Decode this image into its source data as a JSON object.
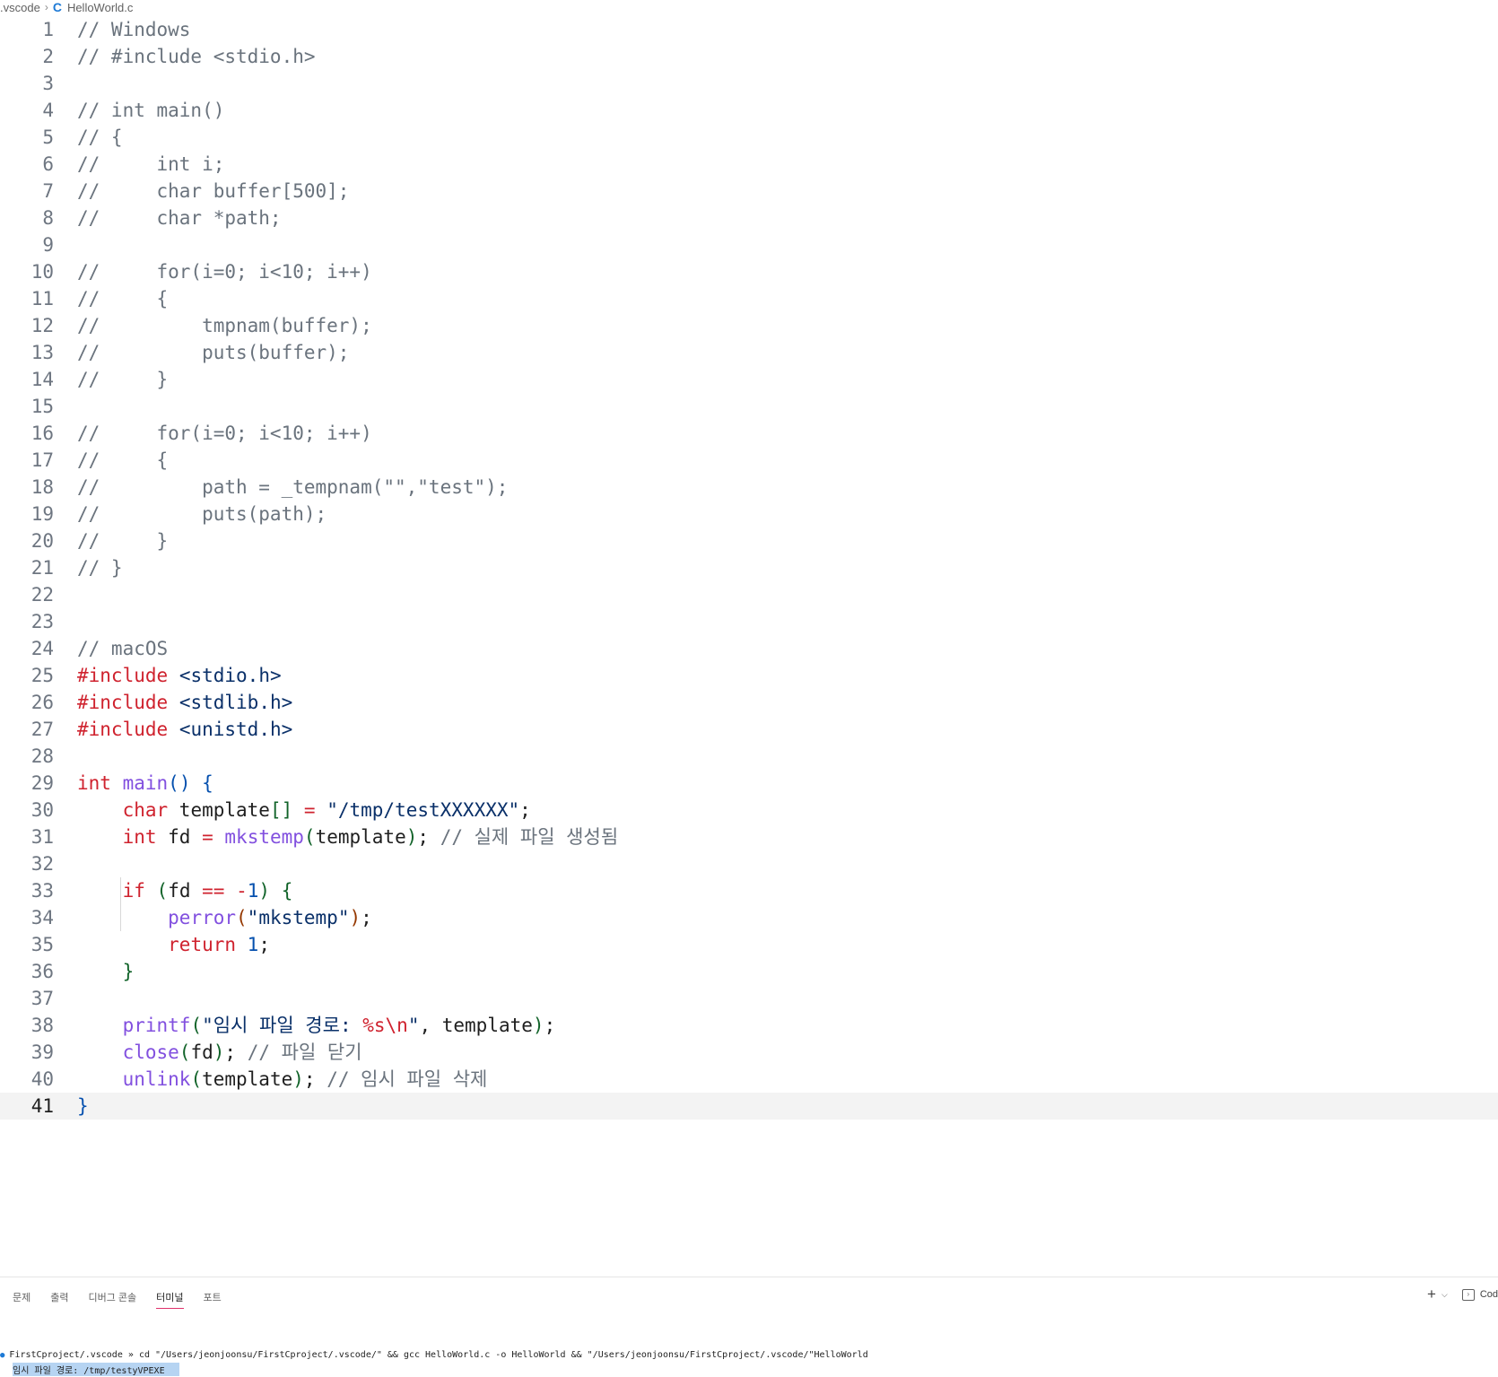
{
  "breadcrumb": {
    "folder": ".vscode",
    "file": "HelloWorld.c",
    "lang_icon": "C"
  },
  "editor": {
    "current_line": 41,
    "lines": [
      {
        "n": "1",
        "t": [
          [
            "c",
            "// Windows"
          ]
        ]
      },
      {
        "n": "2",
        "t": [
          [
            "c",
            "// #include <stdio.h>"
          ]
        ]
      },
      {
        "n": "3",
        "t": []
      },
      {
        "n": "4",
        "t": [
          [
            "c",
            "// int main()"
          ]
        ]
      },
      {
        "n": "5",
        "t": [
          [
            "c",
            "// {"
          ]
        ]
      },
      {
        "n": "6",
        "t": [
          [
            "c",
            "//     int i;"
          ]
        ]
      },
      {
        "n": "7",
        "t": [
          [
            "c",
            "//     char buffer[500];"
          ]
        ]
      },
      {
        "n": "8",
        "t": [
          [
            "c",
            "//     char *path;"
          ]
        ]
      },
      {
        "n": "9",
        "t": []
      },
      {
        "n": "10",
        "t": [
          [
            "c",
            "//     for(i=0; i<10; i++)"
          ]
        ]
      },
      {
        "n": "11",
        "t": [
          [
            "c",
            "//     {"
          ]
        ]
      },
      {
        "n": "12",
        "t": [
          [
            "c",
            "//         tmpnam(buffer);"
          ]
        ]
      },
      {
        "n": "13",
        "t": [
          [
            "c",
            "//         puts(buffer);"
          ]
        ]
      },
      {
        "n": "14",
        "t": [
          [
            "c",
            "//     }"
          ]
        ]
      },
      {
        "n": "15",
        "t": []
      },
      {
        "n": "16",
        "t": [
          [
            "c",
            "//     for(i=0; i<10; i++)"
          ]
        ]
      },
      {
        "n": "17",
        "t": [
          [
            "c",
            "//     {"
          ]
        ]
      },
      {
        "n": "18",
        "t": [
          [
            "c",
            "//         path = _tempnam(\"\",\"test\");"
          ]
        ]
      },
      {
        "n": "19",
        "t": [
          [
            "c",
            "//         puts(path);"
          ]
        ]
      },
      {
        "n": "20",
        "t": [
          [
            "c",
            "//     }"
          ]
        ]
      },
      {
        "n": "21",
        "t": [
          [
            "c",
            "// }"
          ]
        ]
      },
      {
        "n": "22",
        "t": []
      },
      {
        "n": "23",
        "t": []
      },
      {
        "n": "24",
        "t": [
          [
            "c",
            "// macOS"
          ]
        ]
      },
      {
        "n": "25",
        "t": [
          [
            "p",
            "#include"
          ],
          [
            "v",
            " "
          ],
          [
            "s",
            "<stdio.h>"
          ]
        ]
      },
      {
        "n": "26",
        "t": [
          [
            "p",
            "#include"
          ],
          [
            "v",
            " "
          ],
          [
            "s",
            "<stdlib.h>"
          ]
        ]
      },
      {
        "n": "27",
        "t": [
          [
            "p",
            "#include"
          ],
          [
            "v",
            " "
          ],
          [
            "s",
            "<unistd.h>"
          ]
        ]
      },
      {
        "n": "28",
        "t": []
      },
      {
        "n": "29",
        "t": [
          [
            "k",
            "int"
          ],
          [
            "v",
            " "
          ],
          [
            "f",
            "main"
          ],
          [
            "b1",
            "()"
          ],
          [
            "v",
            " "
          ],
          [
            "b1",
            "{"
          ]
        ]
      },
      {
        "n": "30",
        "t": [
          [
            "v",
            "    "
          ],
          [
            "k",
            "char"
          ],
          [
            "v",
            " template"
          ],
          [
            "b2",
            "[]"
          ],
          [
            "v",
            " "
          ],
          [
            "o",
            "="
          ],
          [
            "v",
            " "
          ],
          [
            "s",
            "\"/tmp/testXXXXXX\""
          ],
          [
            "v",
            ";"
          ]
        ]
      },
      {
        "n": "31",
        "t": [
          [
            "v",
            "    "
          ],
          [
            "k",
            "int"
          ],
          [
            "v",
            " fd "
          ],
          [
            "o",
            "="
          ],
          [
            "v",
            " "
          ],
          [
            "f",
            "mkstemp"
          ],
          [
            "b2",
            "("
          ],
          [
            "v",
            "template"
          ],
          [
            "b2",
            ")"
          ],
          [
            "v",
            "; "
          ],
          [
            "c",
            "// 실제 파일 생성됨"
          ]
        ]
      },
      {
        "n": "32",
        "t": []
      },
      {
        "n": "33",
        "t": [
          [
            "v",
            "    "
          ],
          [
            "k",
            "if"
          ],
          [
            "v",
            " "
          ],
          [
            "b2",
            "("
          ],
          [
            "v",
            "fd "
          ],
          [
            "o",
            "=="
          ],
          [
            "v",
            " "
          ],
          [
            "o",
            "-"
          ],
          [
            "num",
            "1"
          ],
          [
            "b2",
            ")"
          ],
          [
            "v",
            " "
          ],
          [
            "b2",
            "{"
          ]
        ]
      },
      {
        "n": "34",
        "t": [
          [
            "v",
            "        "
          ],
          [
            "f",
            "perror"
          ],
          [
            "b3",
            "("
          ],
          [
            "s",
            "\"mkstemp\""
          ],
          [
            "b3",
            ")"
          ],
          [
            "v",
            ";"
          ]
        ]
      },
      {
        "n": "35",
        "t": [
          [
            "v",
            "        "
          ],
          [
            "k",
            "return"
          ],
          [
            "v",
            " "
          ],
          [
            "num",
            "1"
          ],
          [
            "v",
            ";"
          ]
        ]
      },
      {
        "n": "36",
        "t": [
          [
            "v",
            "    "
          ],
          [
            "b2",
            "}"
          ]
        ]
      },
      {
        "n": "37",
        "t": []
      },
      {
        "n": "38",
        "t": [
          [
            "v",
            "    "
          ],
          [
            "f",
            "printf"
          ],
          [
            "b2",
            "("
          ],
          [
            "s",
            "\"임시 파일 경로: "
          ],
          [
            "e",
            "%s\\n"
          ],
          [
            "s",
            "\""
          ],
          [
            "v",
            ", template"
          ],
          [
            "b2",
            ")"
          ],
          [
            "v",
            ";"
          ]
        ]
      },
      {
        "n": "39",
        "t": [
          [
            "v",
            "    "
          ],
          [
            "f",
            "close"
          ],
          [
            "b2",
            "("
          ],
          [
            "v",
            "fd"
          ],
          [
            "b2",
            ")"
          ],
          [
            "v",
            "; "
          ],
          [
            "c",
            "// 파일 닫기"
          ]
        ]
      },
      {
        "n": "40",
        "t": [
          [
            "v",
            "    "
          ],
          [
            "f",
            "unlink"
          ],
          [
            "b2",
            "("
          ],
          [
            "v",
            "template"
          ],
          [
            "b2",
            ")"
          ],
          [
            "v",
            "; "
          ],
          [
            "c",
            "// 임시 파일 삭제"
          ]
        ]
      },
      {
        "n": "41",
        "t": [
          [
            "b1",
            "}"
          ]
        ]
      }
    ]
  },
  "panel": {
    "tabs": [
      {
        "label": "문제",
        "active": false
      },
      {
        "label": "출력",
        "active": false
      },
      {
        "label": "디버그 콘솔",
        "active": false
      },
      {
        "label": "터미널",
        "active": true
      },
      {
        "label": "포트",
        "active": false
      }
    ],
    "actions": {
      "add_label": "+",
      "dropdown": "⌵",
      "terminal_label": "Cod"
    },
    "terminal": {
      "prompt": "FirstCproject/.vscode",
      "arrow": "»",
      "command": "cd \"/Users/jeonjoonsu/FirstCproject/.vscode/\" && gcc HelloWorld.c -o HelloWorld && \"/Users/jeonjoonsu/FirstCproject/.vscode/\"HelloWorld",
      "output": "임시 파일 경로: /tmp/testyVPEXE"
    }
  }
}
